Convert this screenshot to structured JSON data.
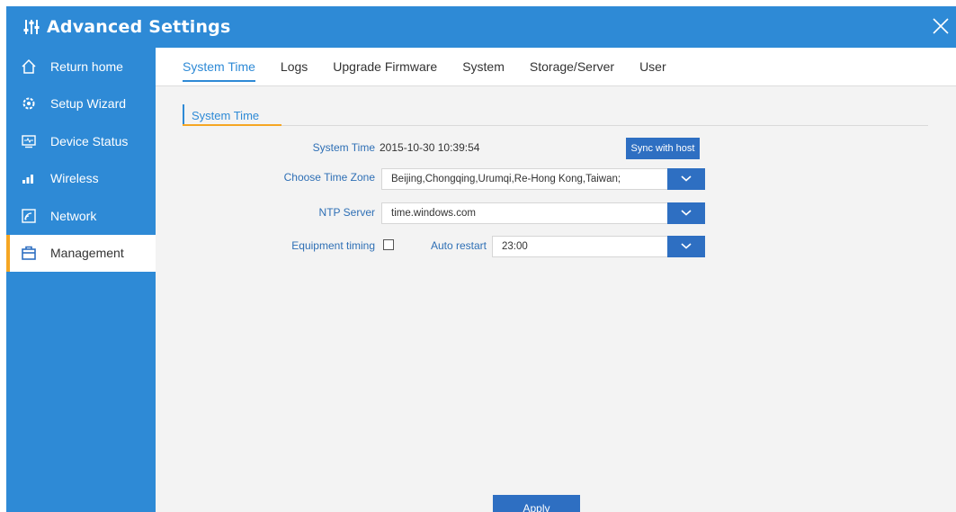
{
  "window": {
    "title": "Advanced Settings",
    "title_icon": "sliders-icon",
    "close_icon": "close-icon"
  },
  "colors": {
    "accent_blue": "#2e8ad6",
    "button_blue": "#2e6fc2",
    "active_marker": "#f5a623",
    "background": "#f3f3f3"
  },
  "sidebar": {
    "items": [
      {
        "label": "Return home",
        "icon": "home-icon",
        "active": false
      },
      {
        "label": "Setup Wizard",
        "icon": "gear-icon",
        "active": false
      },
      {
        "label": "Device Status",
        "icon": "monitor-icon",
        "active": false
      },
      {
        "label": "Wireless",
        "icon": "signal-bars-icon",
        "active": false
      },
      {
        "label": "Network",
        "icon": "network-icon",
        "active": false
      },
      {
        "label": "Management",
        "icon": "briefcase-icon",
        "active": true
      }
    ]
  },
  "tabs": [
    {
      "label": "System Time",
      "active": true
    },
    {
      "label": "Logs",
      "active": false
    },
    {
      "label": "Upgrade Firmware",
      "active": false
    },
    {
      "label": "System",
      "active": false
    },
    {
      "label": "Storage/Server",
      "active": false
    },
    {
      "label": "User",
      "active": false
    }
  ],
  "section": {
    "title": "System Time"
  },
  "form": {
    "system_time_label": "System Time",
    "system_time_value": "2015-10-30 10:39:54",
    "sync_button": "Sync with host",
    "time_zone_label": "Choose Time Zone",
    "time_zone_value": "Beijing,Chongqing,Urumqi,Re-Hong Kong,Taiwan;",
    "ntp_label": "NTP Server",
    "ntp_value": "time.windows.com",
    "equipment_timing_label": "Equipment timing",
    "equipment_timing_checked": false,
    "auto_restart_label": "Auto restart",
    "auto_restart_value": "23:00"
  },
  "footer": {
    "apply_button": "Apply"
  }
}
